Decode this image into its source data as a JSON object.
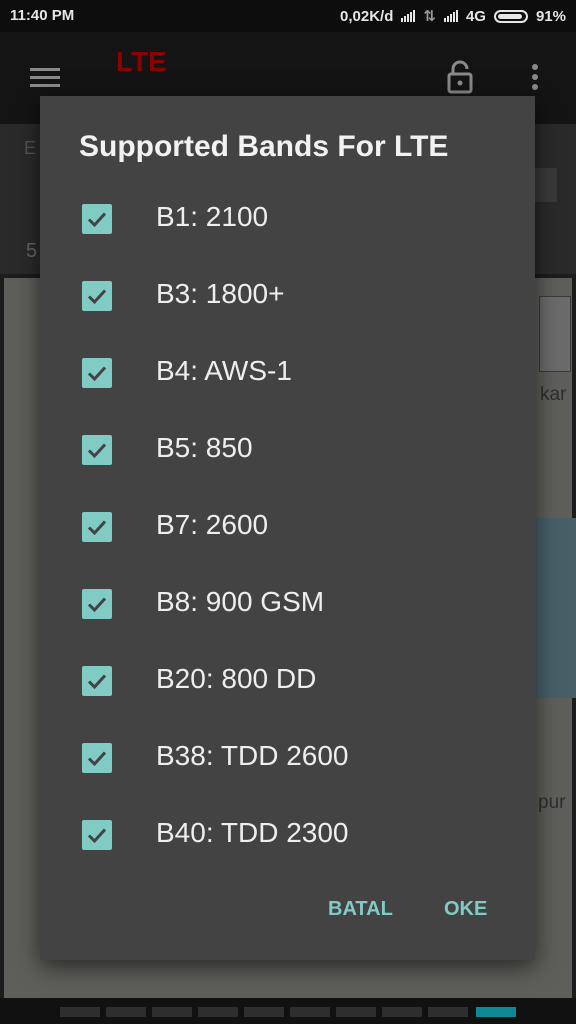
{
  "status_bar": {
    "time": "11:40 PM",
    "data_rate": "0,02K/d",
    "network": "4G",
    "battery": "91%"
  },
  "app_bar": {
    "title": "LTE",
    "icons": [
      "menu-icon",
      "lock-icon",
      "more-vert-icon"
    ]
  },
  "background": {
    "info_fragment_1": "E",
    "info_fragment_2": "5",
    "map_label_1": "kar",
    "map_label_2": "pur"
  },
  "dialog": {
    "title": "Supported Bands For LTE",
    "bands": [
      {
        "label": "B1: 2100",
        "checked": true
      },
      {
        "label": "B3: 1800+",
        "checked": true
      },
      {
        "label": "B4: AWS-1",
        "checked": true
      },
      {
        "label": "B5: 850",
        "checked": true
      },
      {
        "label": "B7: 2600",
        "checked": true
      },
      {
        "label": "B8: 900 GSM",
        "checked": true
      },
      {
        "label": "B20: 800 DD",
        "checked": true
      },
      {
        "label": "B38: TDD 2600",
        "checked": true
      },
      {
        "label": "B40: TDD 2300",
        "checked": true
      }
    ],
    "cancel_label": "BATAL",
    "ok_label": "OKE"
  },
  "colors": {
    "accent": "#80cbc4",
    "dialog_bg": "#434343",
    "app_title": "#8b0000"
  }
}
